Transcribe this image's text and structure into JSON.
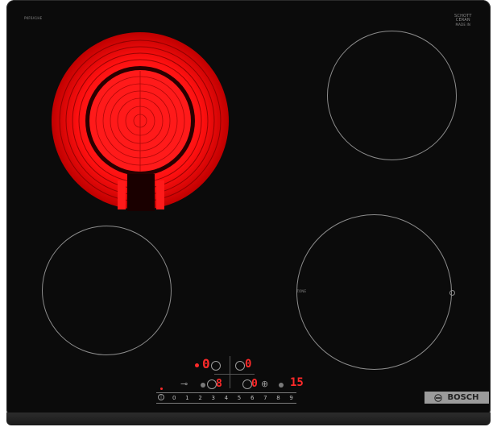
{
  "model_text": "PKF6A1HE",
  "brand_badge": {
    "line1": "SCHOTT",
    "line2": "CERAN",
    "line3": "MADE IN"
  },
  "zone_label": "ZONE",
  "controls": {
    "left_display_top": "0",
    "left_display_bottom": "8",
    "right_display_top": "0",
    "right_display_bottom": "0",
    "timer_display": "15"
  },
  "power_scale": [
    "0",
    "1",
    "2",
    "3",
    "4",
    "5",
    "6",
    "7",
    "8",
    "9"
  ],
  "brand_logo_text": "BOSCH",
  "colors": {
    "glass": "#0b0b0b",
    "hot": "#ff1a1a",
    "ring": "#8c8c8c",
    "badge": "#9b9b9b"
  },
  "icons": [
    "power-icon",
    "key-lock-icon",
    "timer-icon",
    "bosch-logo-icon"
  ]
}
